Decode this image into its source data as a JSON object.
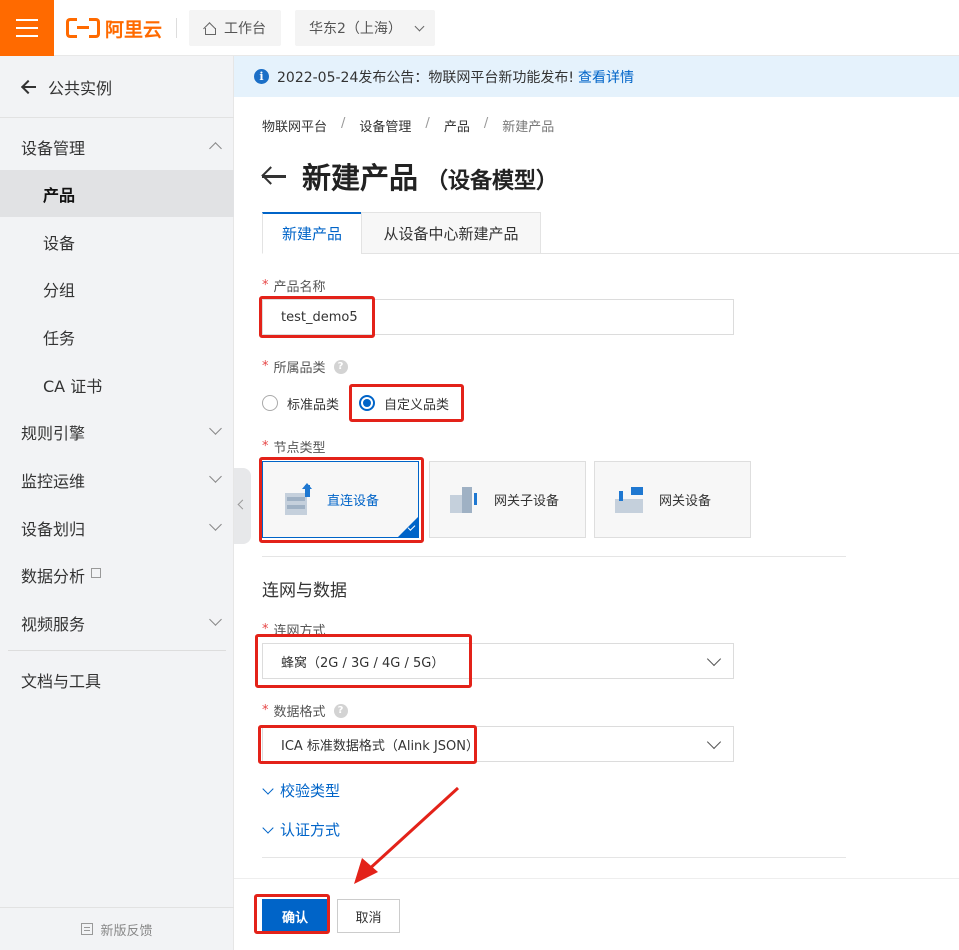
{
  "topbar": {
    "brand": "阿里云",
    "workbench_label": "工作台",
    "region_label": "华东2（上海）"
  },
  "sidebar": {
    "back_label": "公共实例",
    "groups": [
      {
        "label": "设备管理",
        "expanded": true
      },
      {
        "label": "规则引擎"
      },
      {
        "label": "监控运维"
      },
      {
        "label": "设备划归"
      },
      {
        "label": "数据分析"
      },
      {
        "label": "视频服务"
      },
      {
        "label": "文档与工具"
      }
    ],
    "sub_items": [
      "产品",
      "设备",
      "分组",
      "任务",
      "CA 证书"
    ],
    "active_item": "产品",
    "feedback_label": "新版反馈"
  },
  "notice": {
    "text": "2022-05-24发布公告：物联网平台新功能发布!",
    "link": "查看详情"
  },
  "breadcrumb": [
    "物联网平台",
    "设备管理",
    "产品",
    "新建产品"
  ],
  "page": {
    "title": "新建产品",
    "subtitle": "（设备模型）"
  },
  "tabs": [
    "新建产品",
    "从设备中心新建产品"
  ],
  "form": {
    "product_name_label": "产品名称",
    "product_name_value": "test_demo5",
    "category_label": "所属品类",
    "category_options": [
      "标准品类",
      "自定义品类"
    ],
    "category_selected": "自定义品类",
    "node_type_label": "节点类型",
    "node_types": [
      "直连设备",
      "网关子设备",
      "网关设备"
    ],
    "node_type_selected": "直连设备",
    "section_title": "连网与数据",
    "network_label": "连网方式",
    "network_value": "蜂窝（2G / 3G / 4G / 5G）",
    "data_format_label": "数据格式",
    "data_format_value": "ICA 标准数据格式（Alink JSON）",
    "validation_link": "校验类型",
    "auth_link": "认证方式"
  },
  "buttons": {
    "confirm": "确认",
    "cancel": "取消"
  },
  "colors": {
    "brand_orange": "#ff6a00",
    "primary_blue": "#0064c8",
    "highlight_red": "#e32219"
  }
}
